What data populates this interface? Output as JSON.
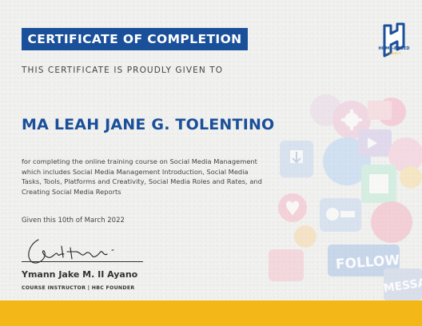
{
  "certificate": {
    "title": "CERTIFICATE OF COMPLETION",
    "given_to_text": "THIS CERTIFICATE IS PROUDLY GIVEN TO",
    "recipient_name": "MA LEAH JANE G. TOLENTINO",
    "description": "for completing the online training course on Social Media Management which includes Social Media Management Introduction, Social Media Tasks, Tools, Platforms and Creativity, Social Media Roles and Rates, and Creating Social Media Reports",
    "date_text": "Given this 10th of March 2022"
  },
  "signer": {
    "name": "Ymann Jake M. II Ayano",
    "role": "COURSE INSTRUCTOR | HBC FOUNDER"
  },
  "logo": {
    "text": "HOME-BASED",
    "subtext": "CONNECT"
  },
  "collage": {
    "follow_label": "FOLLOW",
    "message_label": "MESSAG"
  },
  "colors": {
    "primary_blue": "#1a4f9a",
    "accent_yellow": "#f4b718",
    "background": "#f1f1ef"
  }
}
